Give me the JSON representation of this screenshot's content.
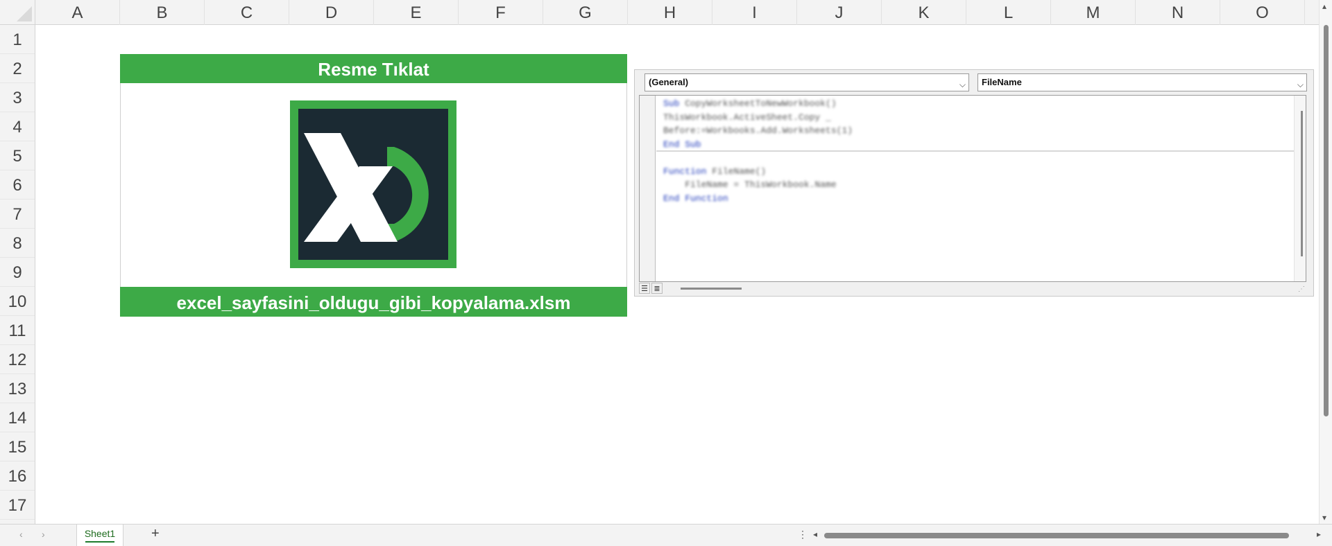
{
  "columns": [
    "A",
    "B",
    "C",
    "D",
    "E",
    "F",
    "G",
    "H",
    "I",
    "J",
    "K",
    "L",
    "M",
    "N",
    "O"
  ],
  "rows": [
    "1",
    "2",
    "3",
    "4",
    "5",
    "6",
    "7",
    "8",
    "9",
    "10",
    "11",
    "12",
    "13",
    "14",
    "15",
    "16",
    "17"
  ],
  "banner": {
    "title": "Resme Tıklat",
    "filename": "excel_sayfasini_oldugu_gibi_kopyalama.xlsm",
    "logo_text": "XD",
    "colors": {
      "green": "#3daa47",
      "dark": "#1b2a33",
      "white": "#ffffff"
    }
  },
  "vba": {
    "object_combo": "(General)",
    "procedure_combo": "FileName",
    "code_lines": [
      {
        "kw": "Sub",
        "rest": " CopyWorksheetToNewWorkbook()"
      },
      {
        "kw": "",
        "rest": "ThisWorkbook.ActiveSheet.Copy _"
      },
      {
        "kw": "",
        "rest": "Before:=Workbooks.Add.Worksheets(1)"
      },
      {
        "kw": "End Sub",
        "rest": ""
      },
      {
        "kw": "",
        "rest": ""
      },
      {
        "kw": "Function",
        "rest": " FileName()"
      },
      {
        "kw": "",
        "rest": "    FileName = ThisWorkbook.Name"
      },
      {
        "kw": "End Function",
        "rest": ""
      }
    ]
  },
  "sheet_tabs": [
    {
      "label": "Sheet1",
      "active": true
    }
  ],
  "add_sheet_label": "+",
  "overflow_dots": "⋮"
}
